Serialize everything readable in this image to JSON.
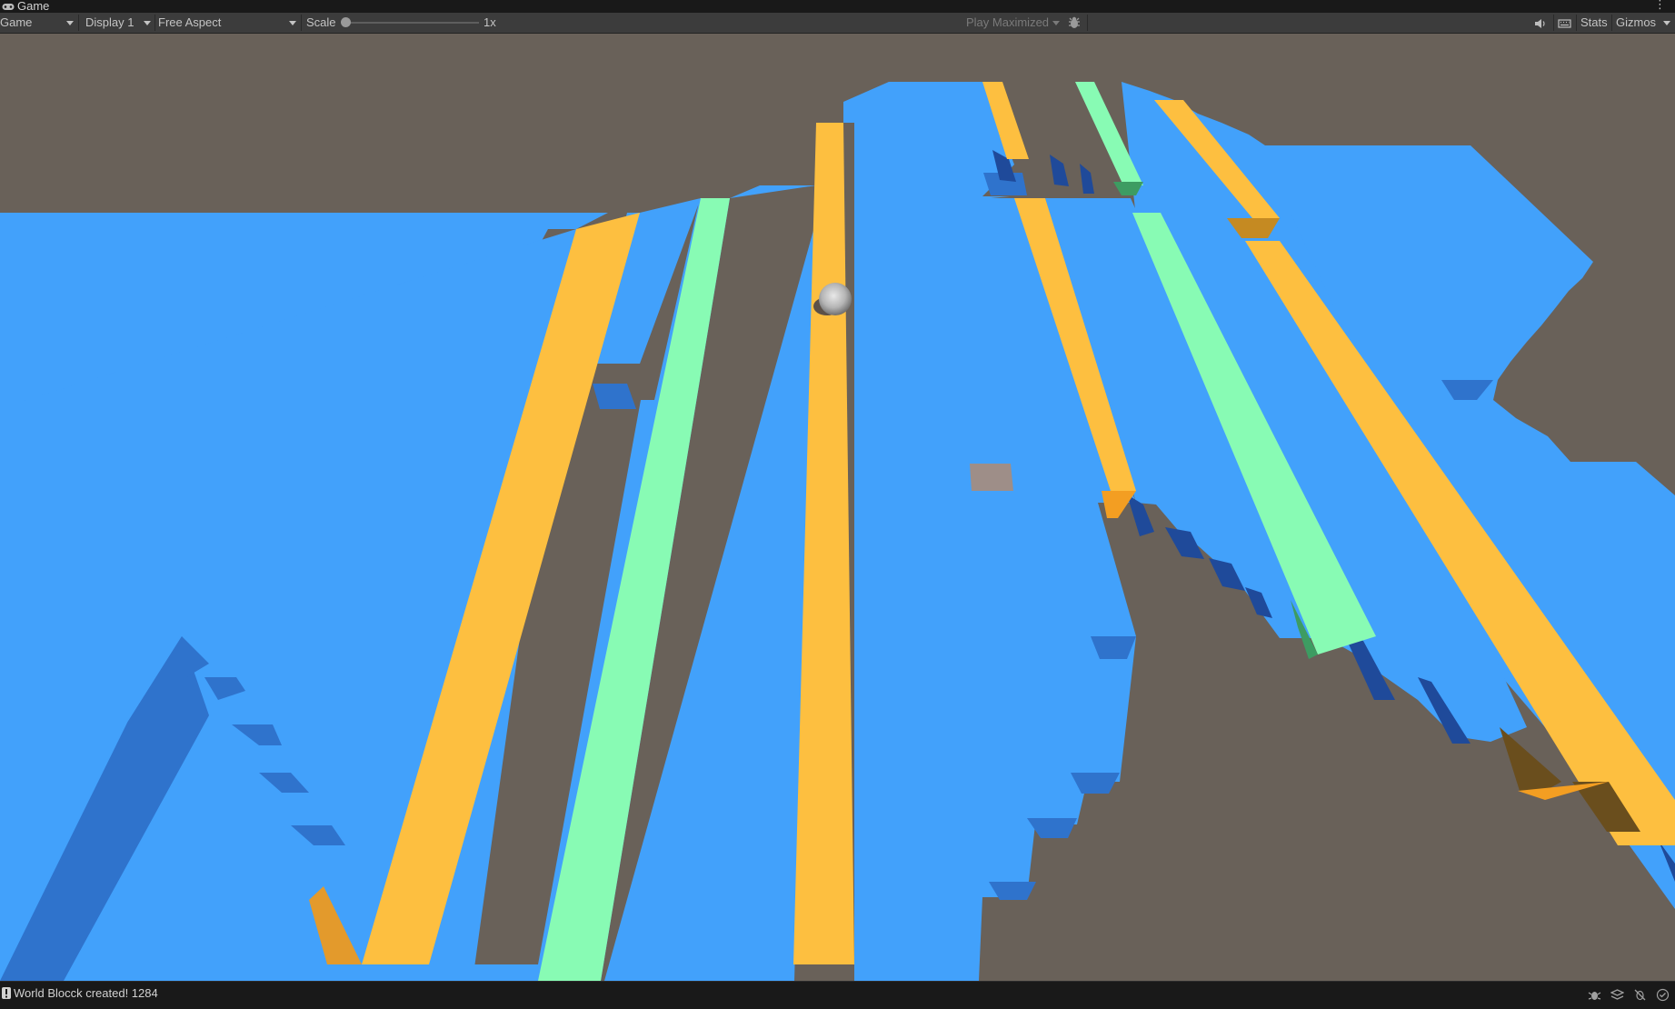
{
  "window": {
    "tab_title": "Game",
    "tab_icon": "gamepad-icon"
  },
  "toolbar": {
    "view_mode": "Game",
    "display": "Display 1",
    "aspect": "Free Aspect",
    "scale_label": "Scale",
    "scale_value": "1x",
    "play_mode": "Play Maximized",
    "stats_label": "Stats",
    "gizmos_label": "Gizmos",
    "icons": [
      "debug-bug-icon",
      "audio-mute-icon",
      "keyboard-icon"
    ]
  },
  "scene": {
    "background_color": "#696159",
    "colors": {
      "blue_top": "#42a1fb",
      "blue_side": "#2f73cc",
      "blue_dark": "#1f4a9a",
      "orange_top": "#fdbf40",
      "orange_side": "#c58a22",
      "orange_dark": "#6a4e1d",
      "green_top": "#88fbb4",
      "green_side": "#3d9c62",
      "marker": "#9e8e88",
      "ball": "#b5b5b5"
    }
  },
  "statusbar": {
    "message": "World Blocck created! 1284",
    "icons": [
      "bug-icon",
      "layers-icon",
      "no-bug-icon",
      "check-circle-icon"
    ]
  }
}
